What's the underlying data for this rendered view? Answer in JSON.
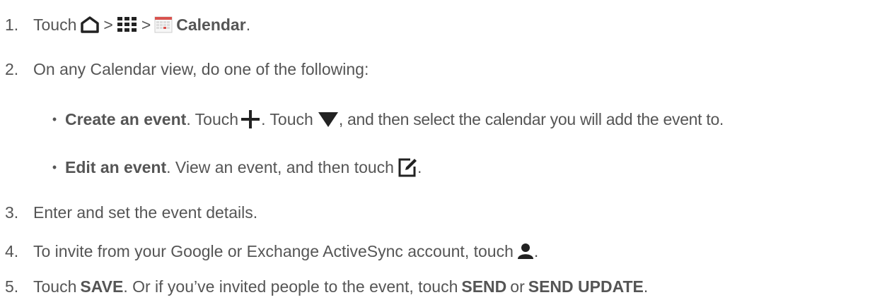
{
  "steps": [
    {
      "num": "1.",
      "text_before": "Touch",
      "sep1": ">",
      "sep2": ">",
      "bold": "Calendar",
      "text_after": "."
    },
    {
      "num": "2.",
      "text": "On any Calendar view, do one of the following:"
    },
    {
      "bullets": [
        {
          "bold": "Create an event",
          "t1": ". Touch",
          "t2": ". Touch",
          "t3": ", and then select the calendar you will add the event to."
        },
        {
          "bold": "Edit an event",
          "t1": ". View an event, and then touch",
          "t2": "."
        }
      ]
    },
    {
      "num": "3.",
      "text": "Enter and set the event details."
    },
    {
      "num": "4.",
      "text": "To invite from your Google or Exchange ActiveSync account, touch",
      "text_after": "."
    },
    {
      "num": "5.",
      "t1": "Touch",
      "b1": "SAVE",
      "t2": ". Or if you’ve invited people to the event, touch",
      "b2": "SEND",
      "t3": "or",
      "b3": "SEND UPDATE",
      "t4": "."
    }
  ],
  "icons": {
    "home": "home-icon",
    "apps": "apps-grid-icon",
    "calendar": "calendar-app-icon",
    "add": "plus-icon",
    "dropdown": "dropdown-triangle-icon",
    "edit": "edit-icon",
    "person": "person-icon"
  },
  "colors": {
    "text": "#555555",
    "icon": "#222222",
    "calendar_red": "#d9534f"
  }
}
